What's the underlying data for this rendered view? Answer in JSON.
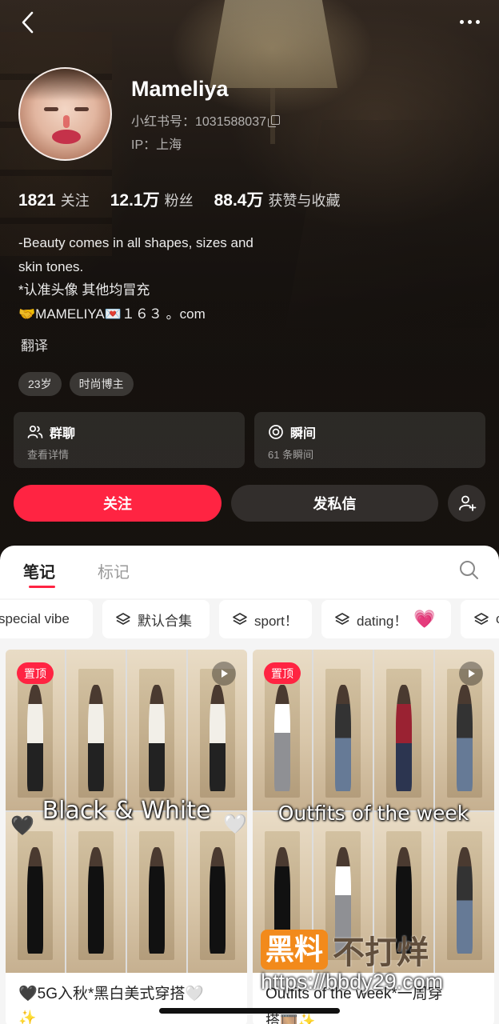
{
  "profile": {
    "nickname": "Mameliya",
    "red_id": "小红书号：1031588037",
    "ip": "IP：上海",
    "stats": [
      {
        "num": "1821",
        "label": "关注"
      },
      {
        "num": "12.1万",
        "label": "粉丝"
      },
      {
        "num": "88.4万",
        "label": "获赞与收藏"
      }
    ],
    "bio_lines": [
      "-Beauty comes in all shapes, sizes and",
      "skin tones.",
      "*认准头像 其他均冒充",
      "🤝MAMELIYA💌１６３ 。com"
    ],
    "translate": "翻译",
    "tags": [
      "23岁",
      "时尚博主"
    ]
  },
  "cards": {
    "group": {
      "title": "群聊",
      "subtitle": "查看详情",
      "icon": "group-chat-icon"
    },
    "moments": {
      "title": "瞬间",
      "subtitle": "61 条瞬间",
      "icon": "moments-icon"
    }
  },
  "actions": {
    "follow": "关注",
    "message": "发私信"
  },
  "tabs": [
    "笔记",
    "标记"
  ],
  "collections": [
    {
      "label": "special vibe"
    },
    {
      "label": "默认合集"
    },
    {
      "label": "sport！"
    },
    {
      "label": "dating！",
      "emoji": "💗"
    },
    {
      "label": "c"
    }
  ],
  "notes": [
    {
      "pin": "置顶",
      "cover_text": "Black & White",
      "title": "🖤5G入秋*黑白美式穿搭🤍",
      "title_line2": "✨"
    },
    {
      "pin": "置顶",
      "cover_text": "Outfits of the week",
      "title": "Outfits of the week*一周穿",
      "title_line2": "搭🎞️✨"
    }
  ],
  "watermark": {
    "brand_a": "黑料",
    "brand_b": "不打烊",
    "url": "https://bbdy29.com"
  },
  "colors": {
    "accent": "#ff2442",
    "background_dark": "#1e1814"
  }
}
